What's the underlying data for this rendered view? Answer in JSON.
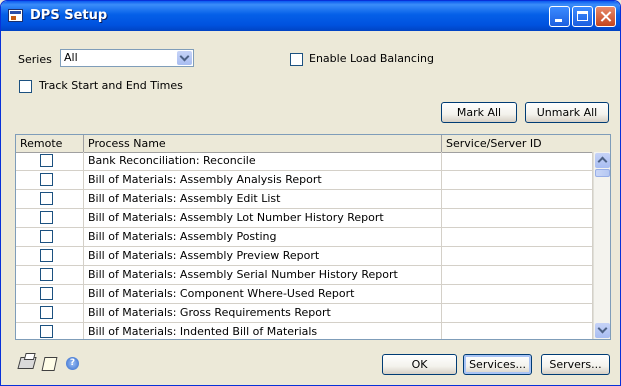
{
  "window": {
    "title": "DPS Setup"
  },
  "series": {
    "label": "Series",
    "value": "All"
  },
  "load_balancing": {
    "label": "Enable Load Balancing",
    "checked": false
  },
  "track_times": {
    "label": "Track Start and End Times",
    "checked": false
  },
  "buttons": {
    "mark_all": "Mark All",
    "unmark_all": "Unmark All",
    "ok": "OK",
    "services": "Services...",
    "servers": "Servers..."
  },
  "grid": {
    "headers": {
      "remote": "Remote",
      "process": "Process Name",
      "service": "Service/Server ID"
    },
    "rows": [
      {
        "process": "Bank Reconciliation: Reconcile",
        "service": ""
      },
      {
        "process": "Bill of Materials: Assembly Analysis Report",
        "service": ""
      },
      {
        "process": "Bill of Materials: Assembly Edit List",
        "service": ""
      },
      {
        "process": "Bill of Materials: Assembly Lot Number History Report",
        "service": ""
      },
      {
        "process": "Bill of Materials: Assembly Posting",
        "service": ""
      },
      {
        "process": "Bill of Materials: Assembly Preview Report",
        "service": ""
      },
      {
        "process": "Bill of Materials: Assembly Serial Number History Report",
        "service": ""
      },
      {
        "process": "Bill of Materials: Component Where-Used Report",
        "service": ""
      },
      {
        "process": "Bill of Materials: Gross Requirements Report",
        "service": ""
      },
      {
        "process": "Bill of Materials: Indented Bill of Materials",
        "service": ""
      }
    ]
  },
  "icons": {
    "print": "printer-icon",
    "note": "note-icon",
    "help": "help-icon",
    "help_glyph": "?"
  }
}
